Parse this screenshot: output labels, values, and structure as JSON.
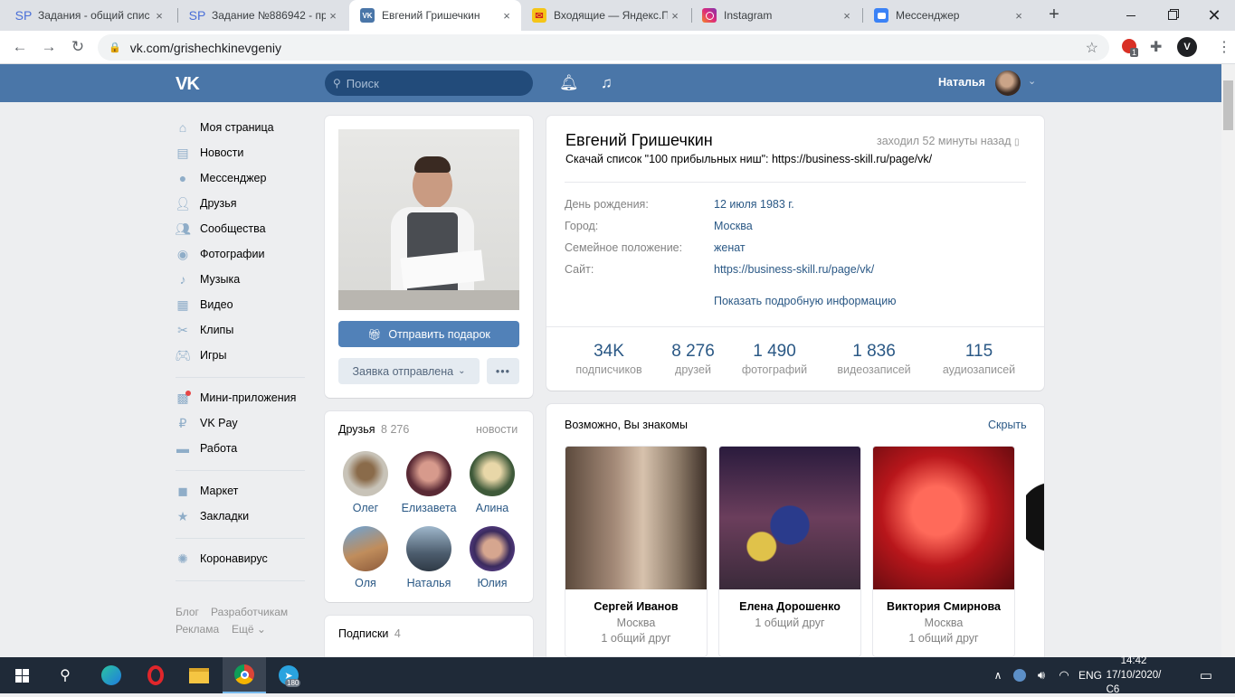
{
  "browser": {
    "tabs": [
      {
        "title": "Задания - общий спис",
        "favicon": "SP"
      },
      {
        "title": "Задание №886942 - пр",
        "favicon": "SP"
      },
      {
        "title": "Евгений Гришечкин",
        "favicon": "VK",
        "active": true
      },
      {
        "title": "Входящие — Яндекс.П",
        "favicon": "mail"
      },
      {
        "title": "Instagram",
        "favicon": "ig"
      },
      {
        "title": "Мессенджер",
        "favicon": "msg"
      }
    ],
    "close_glyph": "×",
    "new_tab": "+",
    "url": "vk.com/grishechkinevgeniy",
    "ext_badge": "1"
  },
  "vk": {
    "logo": "VK",
    "search_placeholder": "Поиск",
    "user_name": "Наталья",
    "menu": [
      {
        "label": "Моя страница",
        "icon": "home-icon"
      },
      {
        "label": "Новости",
        "icon": "news-icon"
      },
      {
        "label": "Мессенджер",
        "icon": "message-icon"
      },
      {
        "label": "Друзья",
        "icon": "person-icon"
      },
      {
        "label": "Сообщества",
        "icon": "group-icon"
      },
      {
        "label": "Фотографии",
        "icon": "camera-icon"
      },
      {
        "label": "Музыка",
        "icon": "music-icon"
      },
      {
        "label": "Видео",
        "icon": "film-icon"
      },
      {
        "label": "Клипы",
        "icon": "clips-icon"
      },
      {
        "label": "Игры",
        "icon": "gamepad-icon"
      },
      {
        "label": "Мини-приложения",
        "icon": "apps-icon"
      },
      {
        "label": "VK Pay",
        "icon": "pay-icon"
      },
      {
        "label": "Работа",
        "icon": "briefcase-icon"
      },
      {
        "label": "Маркет",
        "icon": "bag-icon"
      },
      {
        "label": "Закладки",
        "icon": "star-icon"
      },
      {
        "label": "Коронавирус",
        "icon": "virus-icon"
      }
    ],
    "footer": {
      "blog": "Блог",
      "dev": "Разработчикам",
      "ads": "Реклама",
      "more": "Ещё"
    },
    "profile": {
      "gift_button": "Отправить подарок",
      "request_button": "Заявка отправлена",
      "more_button": "•••",
      "name": "Евгений Гришечкин",
      "last_seen": "заходил 52 минуты назад",
      "status": "Скачай список \"100 прибыльных ниш\": https://business-skill.ru/page/vk/",
      "info": [
        {
          "label": "День рождения:",
          "value": "12 июля 1983 г."
        },
        {
          "label": "Город:",
          "value": "Москва"
        },
        {
          "label": "Семейное положение:",
          "value": "женат"
        },
        {
          "label": "Сайт:",
          "value": "https://business-skill.ru/page/vk/"
        }
      ],
      "show_more": "Показать подробную информацию",
      "stats": [
        {
          "num": "34K",
          "label": "подписчиков"
        },
        {
          "num": "8 276",
          "label": "друзей"
        },
        {
          "num": "1 490",
          "label": "фотографий"
        },
        {
          "num": "1 836",
          "label": "видеозаписей"
        },
        {
          "num": "115",
          "label": "аудиозаписей"
        }
      ]
    },
    "friends": {
      "title": "Друзья",
      "count": "8 276",
      "news": "новости",
      "items": [
        "Олег",
        "Елизавета",
        "Алина",
        "Оля",
        "Наталья",
        "Юлия"
      ]
    },
    "subs": {
      "title": "Подписки",
      "count": "4"
    },
    "maybe": {
      "title": "Возможно, Вы знакомы",
      "hide": "Скрыть",
      "people": [
        {
          "name": "Сергей Иванов",
          "city": "Москва",
          "mutual": "1 общий друг"
        },
        {
          "name": "Елена Дорошенко",
          "city": "1 общий друг",
          "mutual": ""
        },
        {
          "name": "Виктория Смирнова",
          "city": "Москва",
          "mutual": "1 общий друг"
        }
      ]
    }
  },
  "taskbar": {
    "lang": "ENG",
    "time": "14:42",
    "date": "17/10/2020/С6",
    "telegram_badge": "180"
  }
}
